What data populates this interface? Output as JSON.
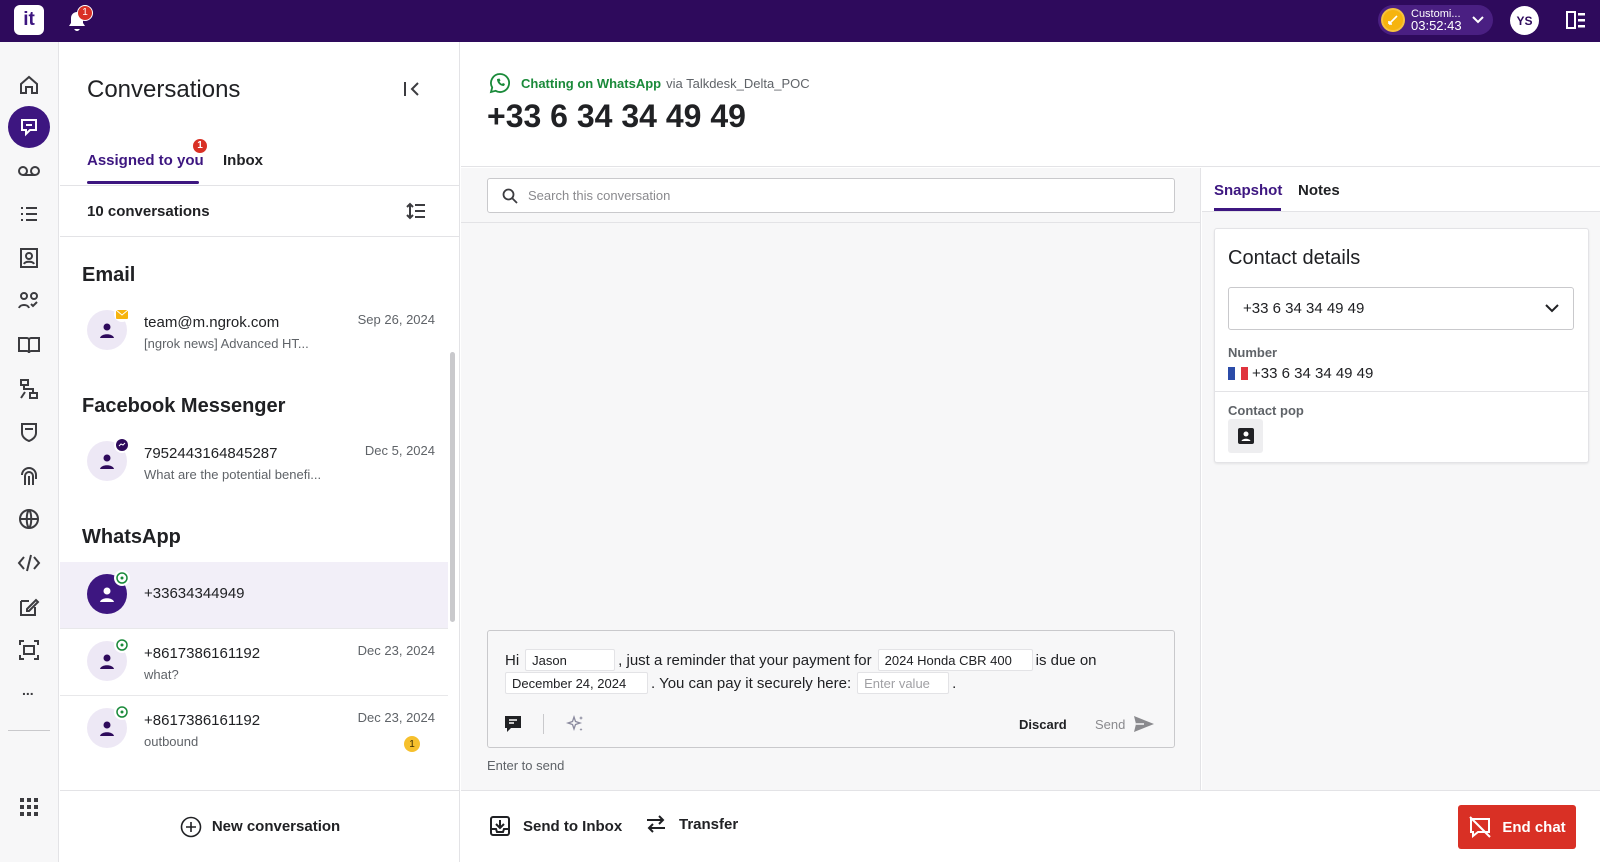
{
  "topbar": {
    "logo_text": "it",
    "notifications_count": "1",
    "status_label": "Customi...",
    "status_timer": "03:52:43",
    "user_initials": "YS",
    "colors": {
      "bar": "#2e0a5c",
      "status": "#f6b40e"
    }
  },
  "nav": {
    "items": [
      "home-icon",
      "conversations-icon",
      "voicemail-icon",
      "list-icon",
      "contacts-icon",
      "teams-icon",
      "knowledge-icon",
      "workflow-icon",
      "shield-icon",
      "fingerprint-icon",
      "globe-icon",
      "code-icon",
      "edit-icon",
      "screen-icon"
    ],
    "more": "..."
  },
  "conversations": {
    "title": "Conversations",
    "tabs": [
      {
        "label": "Assigned to you",
        "badge": "1"
      },
      {
        "label": "Inbox"
      }
    ],
    "count_label": "10 conversations",
    "sections": [
      {
        "title": "Email",
        "items": [
          {
            "name": "team@m.ngrok.com",
            "subtitle": "[ngrok news] Advanced HT...",
            "date": "Sep 26, 2024",
            "channel": "email-icon"
          }
        ]
      },
      {
        "title": "Facebook Messenger",
        "items": [
          {
            "name": "7952443164845287",
            "subtitle": "What are the potential benefi...",
            "date": "Dec 5, 2024",
            "channel": "messenger-icon"
          }
        ]
      },
      {
        "title": "WhatsApp",
        "items": [
          {
            "name": "+33634344949",
            "subtitle": "",
            "date": "",
            "channel": "whatsapp-icon",
            "selected": true
          },
          {
            "name": "+8617386161192",
            "subtitle": "what?",
            "date": "Dec 23, 2024",
            "channel": "whatsapp-icon"
          },
          {
            "name": "+8617386161192",
            "subtitle": "outbound",
            "date": "Dec 23, 2024",
            "channel": "whatsapp-icon",
            "unread": "1"
          }
        ]
      }
    ],
    "new_conversation": "New conversation"
  },
  "header": {
    "channel_label": "Chatting on WhatsApp",
    "via": "via Talkdesk_Delta_POC",
    "phone": "+33 6 34 34 49 49"
  },
  "chat": {
    "search_placeholder": "Search this conversation",
    "message": {
      "p1": "Hi",
      "name": "Jason",
      "p2": ", just a reminder that your payment for",
      "item": "2024 Honda CBR 400",
      "p3": "is due on",
      "date": "December 24, 2024",
      "p4": ". You can pay it securely here:",
      "link_placeholder": "Enter value",
      "p5": "."
    },
    "discard": "Discard",
    "send": "Send",
    "hint": "Enter to send"
  },
  "bottom": {
    "send_to_inbox": "Send to Inbox",
    "transfer": "Transfer",
    "end_chat": "End chat"
  },
  "right": {
    "tabs": [
      "Snapshot",
      "Notes"
    ],
    "card_title": "Contact details",
    "selected_number": "+33 6 34 34 49 49",
    "number_label": "Number",
    "number_value": "+33 6 34 34 49 49",
    "contact_pop_label": "Contact pop"
  }
}
